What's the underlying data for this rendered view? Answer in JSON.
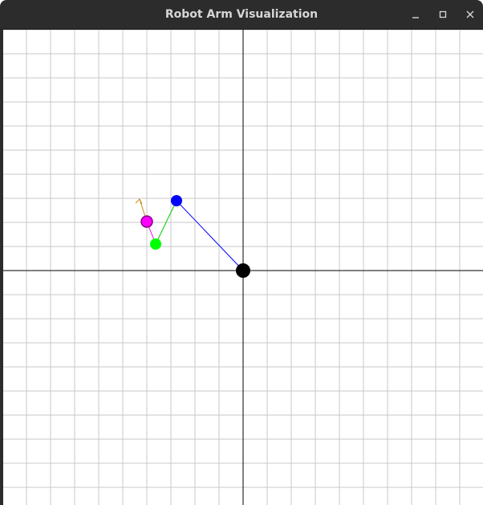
{
  "window": {
    "title": "Robot Arm Visualization",
    "controls": [
      "minimize",
      "maximize",
      "close"
    ]
  },
  "plot": {
    "grid": true,
    "grid_color": "#c8c8c8",
    "axis_color": "#000000",
    "background": "#ffffff"
  },
  "arm": {
    "base_color": "#000000",
    "segments": [
      {
        "name": "link-1",
        "color": "#0000ff"
      },
      {
        "name": "link-2",
        "color": "#00cc00"
      },
      {
        "name": "link-3",
        "color": "#ff00ff"
      }
    ],
    "joints": [
      {
        "name": "base-joint",
        "color": "#000000"
      },
      {
        "name": "joint-1",
        "color": "#0000ff"
      },
      {
        "name": "joint-2",
        "color": "#00ff00"
      },
      {
        "name": "end-effector",
        "color": "#ff00ff"
      }
    ],
    "direction_arrow_color": "#cc8a1a"
  }
}
